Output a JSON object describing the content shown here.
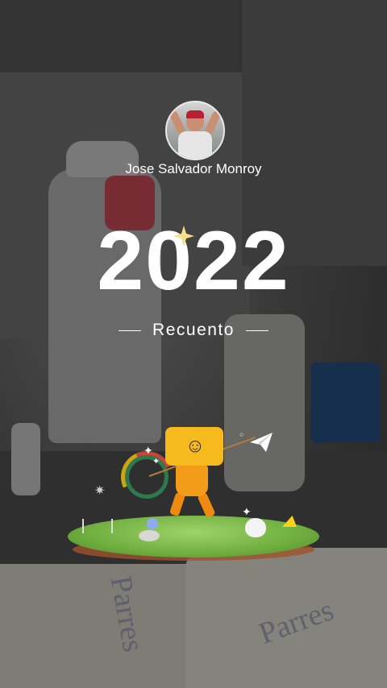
{
  "profile": {
    "username": "Jose Salvador Monroy"
  },
  "recap": {
    "year": "2022",
    "subtitle": "Recuento"
  },
  "background": {
    "bag_text_1": "Parres",
    "bag_text_2": "Parres"
  },
  "colors": {
    "text": "#ffffff",
    "robot_yellow": "#f6b91e",
    "robot_orange": "#f39c1a",
    "grass": "#6fae3f"
  },
  "icons": {
    "sparkle": "sparkle-icon",
    "plane": "paper-plane-icon",
    "robot": "robot-mascot-icon"
  }
}
